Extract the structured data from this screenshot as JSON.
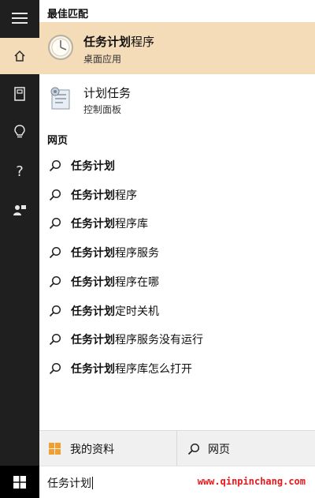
{
  "sections": {
    "best_match": "最佳匹配",
    "web": "网页"
  },
  "best_match_item": {
    "title_bold": "任务计划",
    "title_rest": "程序",
    "subtitle": "桌面应用",
    "icon": "clock-icon"
  },
  "second_item": {
    "title": "计划任务",
    "subtitle": "控制面板",
    "icon": "task-scheduler-icon"
  },
  "web_results": [
    {
      "bold": "任务计划",
      "rest": ""
    },
    {
      "bold": "任务计划",
      "rest": "程序"
    },
    {
      "bold": "任务计划",
      "rest": "程序库"
    },
    {
      "bold": "任务计划",
      "rest": "程序服务"
    },
    {
      "bold": "任务计划",
      "rest": "程序在哪"
    },
    {
      "bold": "任务计划",
      "rest": "定时关机"
    },
    {
      "bold": "任务计划",
      "rest": "程序服务没有运行"
    },
    {
      "bold": "任务计划",
      "rest": "程序库怎么打开"
    }
  ],
  "tabs": {
    "my_stuff": "我的资料",
    "web": "网页"
  },
  "search": {
    "value": "任务计划"
  },
  "watermark": "www.qinpinchang.com",
  "colors": {
    "highlight": "#f5dcb8",
    "rail": "#1f1f1f",
    "watermark": "#e8171b",
    "windows_orange": "#f0a030"
  },
  "rail_icons": [
    "hamburger-icon",
    "home-icon",
    "notebook-icon",
    "lightbulb-icon",
    "help-icon",
    "feedback-icon"
  ]
}
